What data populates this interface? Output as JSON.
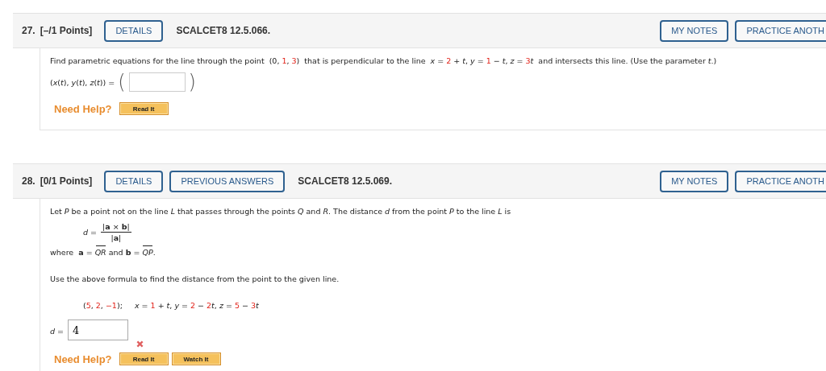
{
  "questions": [
    {
      "number": "27.",
      "points": "[–/1 Points]",
      "header_buttons": [
        "DETAILS"
      ],
      "code": "SCALCET8 12.5.066.",
      "right_buttons": [
        "MY NOTES",
        "PRACTICE ANOTH"
      ],
      "blocks": [
        {
          "kind": "para",
          "segments": [
            {
              "kind": "plain",
              "text": "Find parametric equations for the line through the point  (0, "
            },
            {
              "kind": "value",
              "text": "1"
            },
            {
              "kind": "plain",
              "text": ", "
            },
            {
              "kind": "value",
              "text": "3"
            },
            {
              "kind": "plain",
              "text": ")  that is perpendicular to the line  *x* = "
            },
            {
              "kind": "value",
              "text": "2"
            },
            {
              "kind": "plain",
              "text": " + *t*, *y* = "
            },
            {
              "kind": "value",
              "text": "1"
            },
            {
              "kind": "plain",
              "text": " − *t*, *z* = "
            },
            {
              "kind": "value",
              "text": "3"
            },
            {
              "kind": "plain",
              "text": "*t*  and intersects this line. (Use the parameter *t*.)"
            }
          ]
        },
        {
          "kind": "tuple_answer",
          "label": "(*x*(*t*), *y*(*t*), *z*(*t*)) =",
          "open": "(",
          "close": ")"
        },
        {
          "kind": "help",
          "label": "Need Help?",
          "buttons": [
            "Read It"
          ]
        }
      ]
    },
    {
      "number": "28.",
      "points": "[0/1 Points]",
      "header_buttons": [
        "DETAILS",
        "PREVIOUS ANSWERS"
      ],
      "code": "SCALCET8 12.5.069.",
      "right_buttons": [
        "MY NOTES",
        "PRACTICE ANOTH"
      ],
      "blocks": [
        {
          "kind": "para",
          "segments": [
            {
              "kind": "plain",
              "text": "Let *P* be a point not on the line *L* that passes through the points *Q* and *R*. The distance *d* from the point *P* to the line *L* is"
            }
          ]
        },
        {
          "kind": "fraction",
          "label": "*d* =",
          "numerator": "|**a** × **b**|",
          "denominator": "|**a**|"
        },
        {
          "kind": "para",
          "segments": [
            {
              "kind": "plain",
              "text": "where  **a** = "
            },
            {
              "kind": "vector",
              "text": "*QR*"
            },
            {
              "kind": "plain",
              "text": " and **b** = "
            },
            {
              "kind": "vector",
              "text": "*QP*"
            },
            {
              "kind": "plain",
              "text": "."
            }
          ]
        },
        {
          "kind": "para",
          "segments": [
            {
              "kind": "plain",
              "text": "Use the above formula to find the distance from the point to the given line."
            }
          ]
        },
        {
          "kind": "given",
          "segments": [
            {
              "kind": "plain",
              "text": "("
            },
            {
              "kind": "value",
              "text": "5"
            },
            {
              "kind": "plain",
              "text": ", "
            },
            {
              "kind": "value",
              "text": "2"
            },
            {
              "kind": "plain",
              "text": ", "
            },
            {
              "kind": "value",
              "text": "−1"
            },
            {
              "kind": "plain",
              "text": ");     *x* = "
            },
            {
              "kind": "value",
              "text": "1"
            },
            {
              "kind": "plain",
              "text": " + *t*, *y* = "
            },
            {
              "kind": "value",
              "text": "2"
            },
            {
              "kind": "plain",
              "text": " − "
            },
            {
              "kind": "value",
              "text": "2"
            },
            {
              "kind": "plain",
              "text": "*t*, *z* = "
            },
            {
              "kind": "value",
              "text": "5"
            },
            {
              "kind": "plain",
              "text": " − "
            },
            {
              "kind": "value",
              "text": "3"
            },
            {
              "kind": "plain",
              "text": "*t*"
            }
          ]
        },
        {
          "kind": "answer",
          "label": "*d* =",
          "value": "4",
          "correct": false
        },
        {
          "kind": "help",
          "label": "Need Help?",
          "buttons": [
            "Read It",
            "Watch It"
          ]
        }
      ]
    }
  ]
}
